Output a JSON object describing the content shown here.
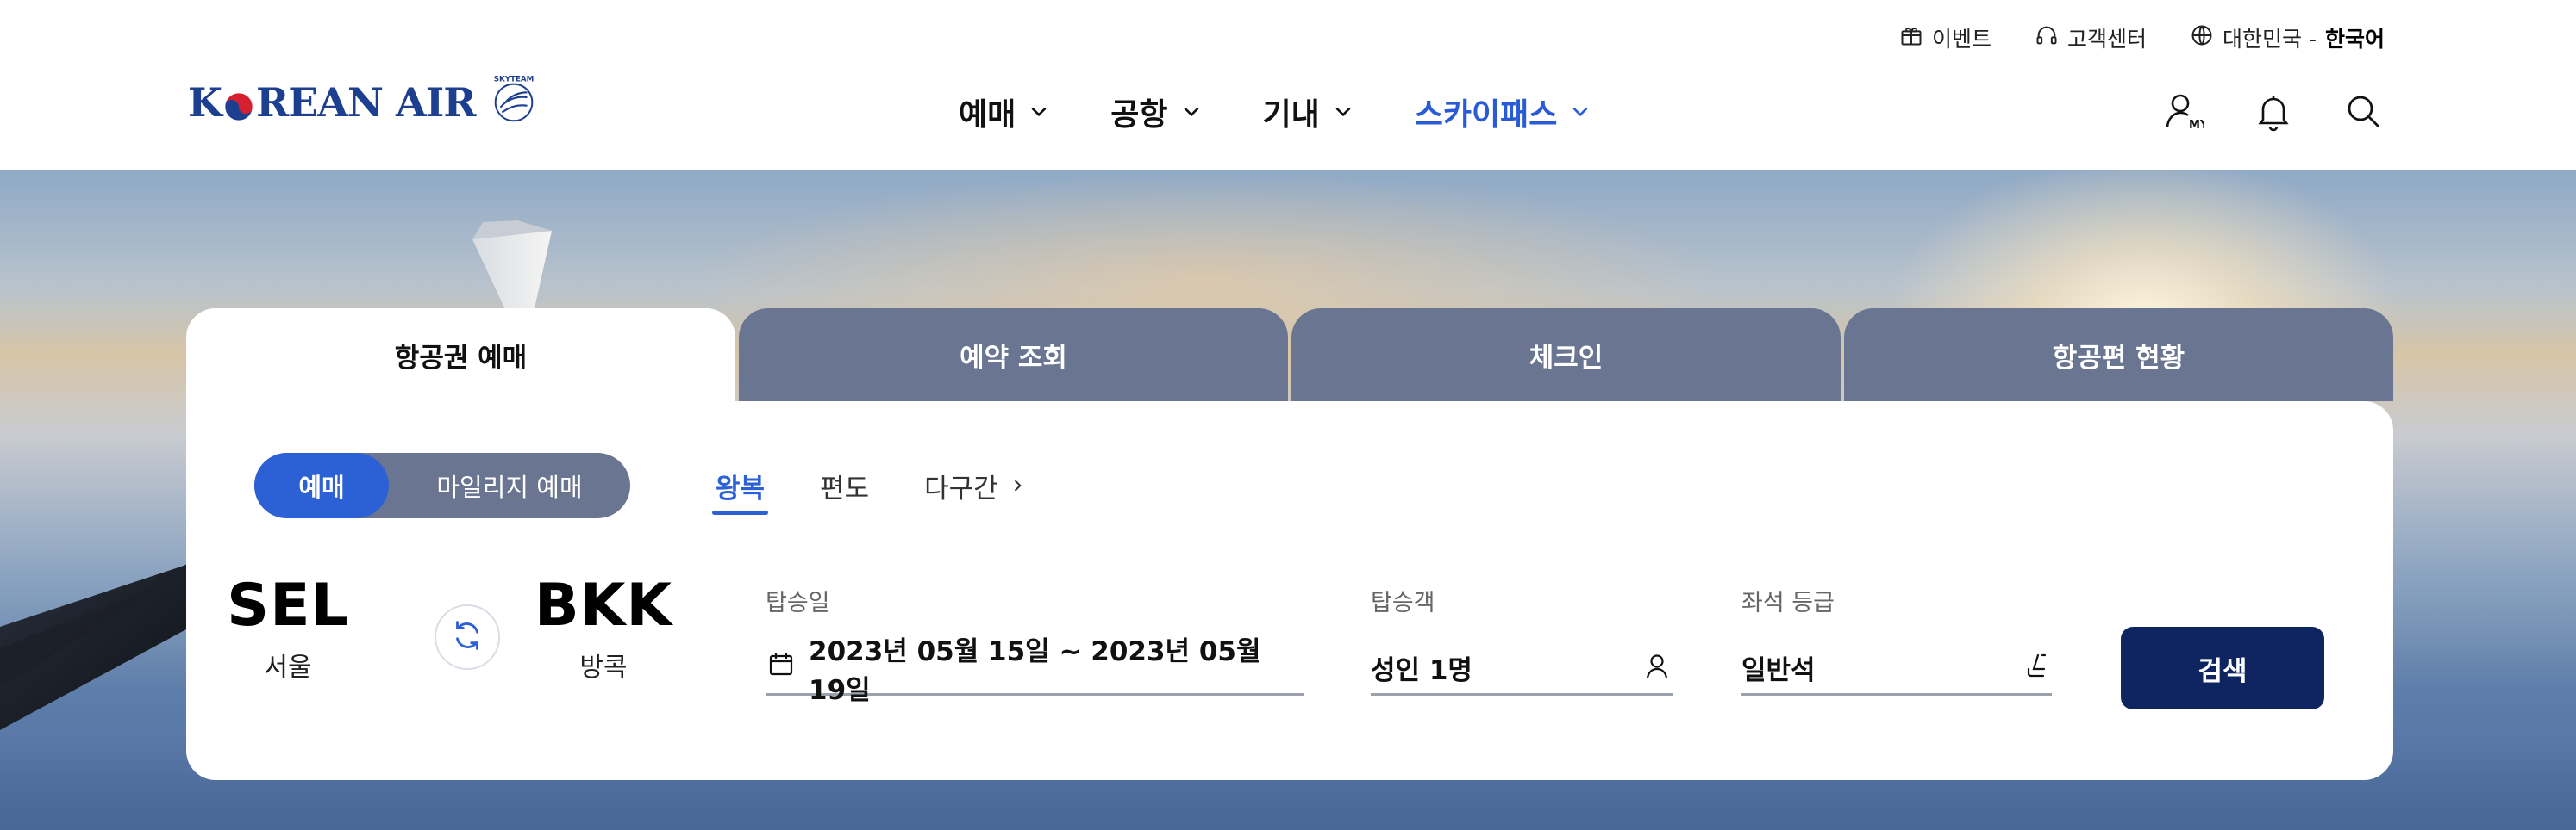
{
  "header": {
    "util_links": {
      "event": "이벤트",
      "support": "고객센터",
      "region": "대한민국 -",
      "language": "한국어"
    },
    "logo": {
      "text_before": "K",
      "text_after": "REAN AIR",
      "mark": "SKYTEAM"
    },
    "nav": {
      "booking": "예매",
      "airport": "공항",
      "inflight": "기내",
      "skypass": "스카이패스"
    },
    "icons": [
      "my-page-icon",
      "bell-icon",
      "search-icon"
    ],
    "my_badge": "MY"
  },
  "widget": {
    "tabs": {
      "ticket": "항공권 예매",
      "reservation": "예약 조회",
      "checkin": "체크인",
      "flight_status": "항공편 현황"
    },
    "mode": {
      "booking": "예매",
      "mileage": "마일리지 예매"
    },
    "trip_types": {
      "round": "왕복",
      "oneway": "편도",
      "multi": "다구간"
    },
    "origin": {
      "code": "SEL",
      "city": "서울"
    },
    "destination": {
      "code": "BKK",
      "city": "방콕"
    },
    "date": {
      "label": "탑승일",
      "value": "2023년 05월 15일 ~ 2023년 05월 19일"
    },
    "passengers": {
      "label": "탑승객",
      "value": "성인 1명"
    },
    "cabin": {
      "label": "좌석 등급",
      "value": "일반석"
    },
    "search_button": "검색"
  },
  "colors": {
    "brand_blue": "#2c61d6",
    "tab_gray": "#6a7691",
    "search_navy": "#0e2561",
    "logo_blue": "#1d3f8f"
  }
}
